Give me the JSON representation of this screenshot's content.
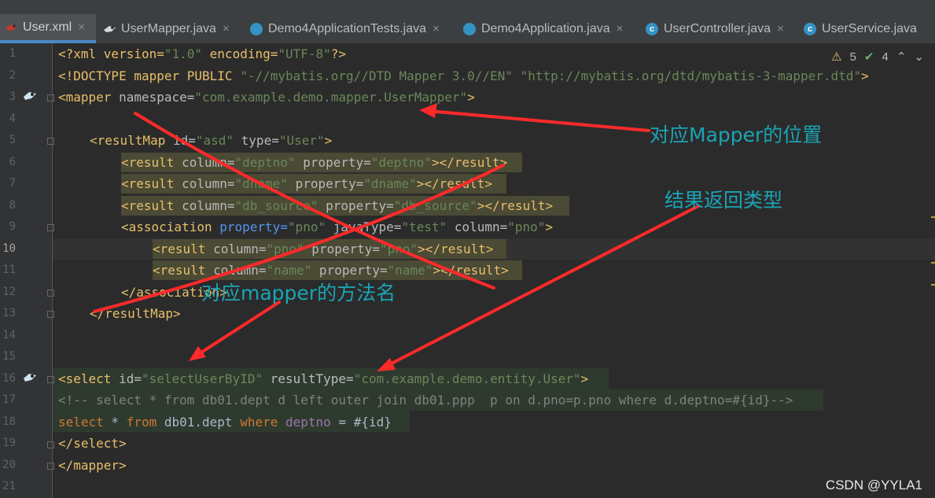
{
  "tabs": [
    {
      "label": "User.xml",
      "icon": "mybatis-icon",
      "active": true,
      "close": "×"
    },
    {
      "label": "UserMapper.java",
      "icon": "mybatis-icon",
      "close": "×"
    },
    {
      "label": "Demo4ApplicationTests.java",
      "icon": "class-icon",
      "close": "×"
    },
    {
      "label": "Demo4Application.java",
      "icon": "class-icon",
      "close": "×"
    },
    {
      "label": "UserController.java",
      "icon": "class-icon",
      "close": "×"
    },
    {
      "label": "UserService.java",
      "icon": "class-icon"
    }
  ],
  "status": {
    "warnings": "5",
    "checks": "4"
  },
  "line_numbers": [
    "1",
    "2",
    "3",
    "4",
    "5",
    "6",
    "7",
    "8",
    "9",
    "10",
    "11",
    "12",
    "13",
    "14",
    "15",
    "16",
    "17",
    "18",
    "19",
    "20",
    "21"
  ],
  "code": {
    "l1": [
      "<?xml version=",
      "\"1.0\"",
      " encoding=",
      "\"UTF-8\"",
      "?>"
    ],
    "l2": [
      "<!DOCTYPE mapper PUBLIC ",
      "\"-//mybatis.org//DTD Mapper 3.0//EN\"",
      " ",
      "\"http://mybatis.org/dtd/mybatis-3-mapper.dtd\"",
      ">"
    ],
    "l3": [
      "<mapper",
      " namespace=",
      "\"com.example.demo.mapper.UserMapper\"",
      ">"
    ],
    "l5": [
      "<resultMap",
      " id=",
      "\"asd\"",
      " type=",
      "\"User\"",
      ">"
    ],
    "l6": [
      "<result",
      " column=",
      "\"deptno\"",
      " property=",
      "\"deptno\"",
      "></result>"
    ],
    "l7": [
      "<result",
      " column=",
      "\"dname\"",
      " property=",
      "\"dname\"",
      "></result>"
    ],
    "l8": [
      "<result",
      " column=",
      "\"db_source\"",
      " property=",
      "\"db_source\"",
      "></result>"
    ],
    "l9": [
      "<association",
      " property=",
      "\"pno\"",
      " javaType=",
      "\"test\"",
      " column=",
      "\"pno\"",
      ">"
    ],
    "l10": [
      "<result",
      " column=",
      "\"pno\"",
      " property=",
      "\"pno\"",
      "></result>"
    ],
    "l11": [
      "<result",
      " column=",
      "\"name\"",
      " property=",
      "\"name\"",
      "></result>"
    ],
    "l12": [
      "</association>"
    ],
    "l13": [
      "</resultMap>"
    ],
    "l16": [
      "<select",
      " id=",
      "\"selectUserByID\"",
      " resultType=",
      "\"com.example.demo.entity.User\"",
      ">"
    ],
    "l17": [
      "<!-- select * from db01.dept d left outer join db01.ppp  p on d.pno=p.pno where d.deptno=#{id}-->"
    ],
    "l18": [
      "select",
      " * ",
      "from",
      " db01.dept ",
      "where",
      " ",
      "deptno",
      " = #{id}"
    ],
    "l19": [
      "</select>"
    ],
    "l20": [
      "</mapper>"
    ]
  },
  "annotations": {
    "mapper_position": "对应Mapper的位置",
    "result_type": "结果返回类型",
    "method_name": "对应mapper的方法名"
  },
  "watermark": "CSDN @YYLA1",
  "colors": {
    "background": "#2b2b2b",
    "annotation": "#1aa4b5",
    "arrow": "#ff2a2a"
  }
}
